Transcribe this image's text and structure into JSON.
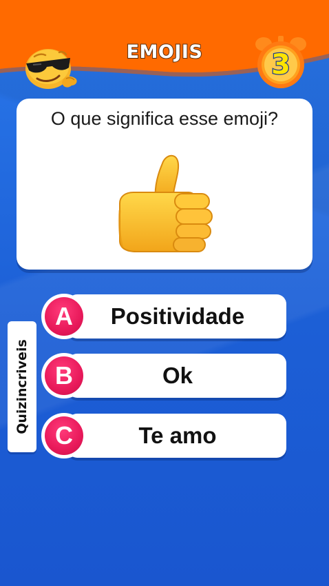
{
  "header": {
    "title": "EMOJIS",
    "timer": "3",
    "left_icon": "cool-sunglasses-emoji"
  },
  "question": {
    "text": "O que significa esse emoji?",
    "emoji": "thumbs-up"
  },
  "answers": [
    {
      "letter": "A",
      "label": "Positividade"
    },
    {
      "letter": "B",
      "label": "Ok"
    },
    {
      "letter": "C",
      "label": "Te amo"
    }
  ],
  "side_tag": "Quizincriveis",
  "colors": {
    "header_orange": "#ff6a00",
    "background_blue": "#1f63d8",
    "badge_pink": "#e8195a",
    "timer_yellow": "#ffe400"
  }
}
